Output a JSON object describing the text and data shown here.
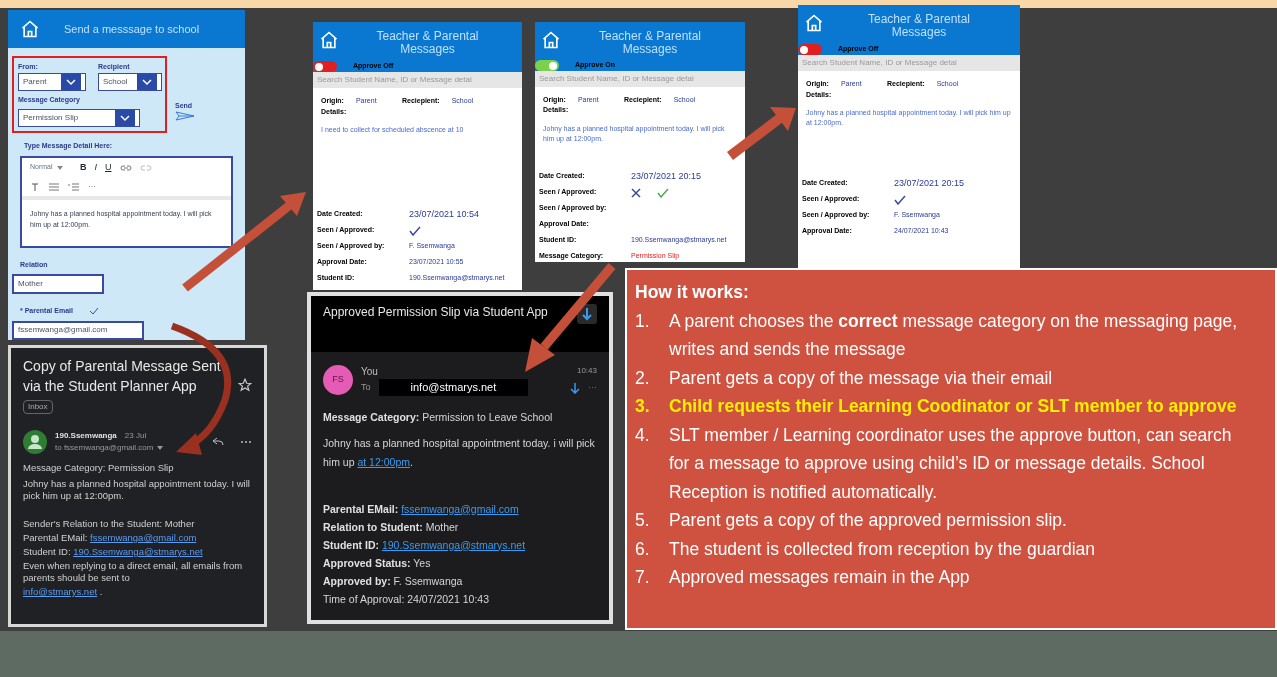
{
  "send_form": {
    "title": "Send a messsage to school",
    "from_label": "From:",
    "from_value": "Parent",
    "recipient_label": "Recipient",
    "recipient_value": "School",
    "category_label": "Message Category",
    "category_value": "Permission Slip",
    "send_label": "Send",
    "detail_label": "Type Message Detail Here:",
    "style_value": "Normal",
    "format_buttons": [
      "B",
      "I",
      "U"
    ],
    "more": "···",
    "message": "Johny has a planned hospital appointment today. I will pick him up at 12:00pm.",
    "relation_label": "Relation",
    "relation_value": "Mother",
    "email_label": "* Parental Email",
    "email_value": "fssemwanga@gmail.com"
  },
  "copy_email": {
    "title": "Copy of Parental Message Sent via the Student Planner App",
    "tag": "Inbox",
    "sender": "190.Ssemwanga",
    "date": "23 Jul",
    "to": "to fssemwanga@gmail.com",
    "body": [
      {
        "text": "Message Category: Permission Slip"
      },
      {
        "text": "Johny has a planned hospital appointment today. I will pick him up at 12:00pm."
      }
    ],
    "details": [
      {
        "text": "Sender's Relation to the Student: Mother"
      },
      {
        "text": "Parental EMail: ",
        "link": "fssemwanga@gmail.com"
      },
      {
        "text": "Student ID: ",
        "link": "190.Ssemwanga@stmarys.net"
      },
      {
        "text": "Even when replying to a direct email, all emails from parents should be sent to"
      },
      {
        "link": "info@stmarys.net",
        "after": " ."
      }
    ]
  },
  "approval_panels": [
    {
      "title": "Teacher & Parental Messages",
      "toggle": {
        "on": false,
        "label": "Approve Off"
      },
      "search_placeholder": "Search Student Name, ID or Message detai",
      "origin_label": "Origin:",
      "origin": "Parent",
      "recipient_label": "Reciepient:",
      "recipient": "School",
      "details_label": "Details:",
      "message": "I need to collect for scheduled abscence at 10",
      "fields": [
        {
          "kind": "date",
          "label": "Date Created:",
          "value": "23/07/2021 10:54"
        },
        {
          "kind": "status",
          "label": "Seen / Approved:",
          "approved": true
        },
        {
          "kind": "text",
          "label": "Seen / Approved by:",
          "value": "F. Ssemwanga"
        },
        {
          "kind": "text",
          "label": "Approval Date:",
          "value": "23/07/2021 10:55"
        },
        {
          "kind": "text",
          "label": "Student ID:",
          "value": "190.Ssemwanga@stmarys.net"
        }
      ]
    },
    {
      "title": "Teacher & Parental Messages",
      "toggle": {
        "on": true,
        "label": "Approve On"
      },
      "search_placeholder": "Search Student Name, ID or Message detai",
      "origin_label": "Origin:",
      "origin": "Parent",
      "recipient_label": "Reciepient:",
      "recipient": "School",
      "details_label": "Details:",
      "message": "Johny has a planned hospital appointment today. I will pick him up at 12:00pm.",
      "fields": [
        {
          "kind": "date",
          "label": "Date Created:",
          "value": "23/07/2021 20:15"
        },
        {
          "kind": "status",
          "label": "Seen / Approved:",
          "approved": false
        },
        {
          "kind": "text",
          "label": "Seen / Approved by:"
        },
        {
          "kind": "text",
          "label": "Approval Date:"
        },
        {
          "kind": "text",
          "label": "Student ID:",
          "value": "190.Ssemwanga@stmarys.net"
        },
        {
          "kind": "category",
          "label": "Message Category:",
          "value": "Permission Slip"
        }
      ]
    },
    {
      "title": "Teacher & Parental Messages",
      "toggle": {
        "on": false,
        "label": "Approve Off"
      },
      "search_placeholder": "Search Student Name, ID or Message detai",
      "origin_label": "Origin:",
      "origin": "Parent",
      "recipient_label": "Reciepient:",
      "recipient": "School",
      "details_label": "Details:",
      "message": "Johny has a planned hospital appointment today. I will pick him up at 12:00pm.",
      "fields": [
        {
          "kind": "date",
          "label": "Date Created:",
          "value": "23/07/2021 20:15"
        },
        {
          "kind": "status",
          "label": "Seen / Approved:",
          "approved": true
        },
        {
          "kind": "text",
          "label": "Seen / Approved by:",
          "value": "F. Ssemwanga"
        },
        {
          "kind": "text",
          "label": "Approval Date:",
          "value": "24/07/2021 10:43"
        }
      ]
    }
  ],
  "approved_email": {
    "title": "Approved Permission Slip via Student App",
    "avatar": "FS",
    "from": "You",
    "to_label": "To",
    "to": "info@stmarys.net",
    "time": "10:43",
    "more": "···",
    "category_label": "Message Category:",
    "category": "Permission to Leave School",
    "message": "Johny has a planned hospital appointment today. i will pick him up ",
    "message_link": "at 12:00pm",
    "message_end": ".",
    "rows": [
      {
        "label": "Parental EMail:",
        "value": "fssemwanga@gmail.com",
        "kind": "link"
      },
      {
        "label": "Relation to Student:",
        "value": "Mother",
        "kind": "text"
      },
      {
        "label": "Student ID:",
        "value": "190.Ssemwanga@stmarys.net",
        "kind": "link"
      },
      {
        "label": "Approved Status:",
        "value": "Yes",
        "kind": "text"
      },
      {
        "label": "Approved by:",
        "value": "F. Ssemwanga",
        "kind": "text"
      },
      {
        "label": "Time of Approval:",
        "value": "24/07/2021 10:43",
        "kind": "plain"
      }
    ]
  },
  "how_it_works": {
    "title": "How it works:",
    "steps": [
      {
        "number": "1.",
        "text": "A parent chooses the **correct** message category on the messaging page, writes and sends the message",
        "highlight": false
      },
      {
        "number": "2.",
        "text": "Parent gets a copy of the message via their email",
        "highlight": false
      },
      {
        "number": "3.",
        "text": "Child requests their Learning Coodinator or SLT member to approve",
        "highlight": true
      },
      {
        "number": "4.",
        "text": "SLT member / Learning coordinator uses the approve button, can search for a message to approve using child’s ID or message details.  School Reception is notified automatically.",
        "highlight": false
      },
      {
        "number": "5.",
        "text": "Parent gets a copy of the approved permission slip.",
        "highlight": false
      },
      {
        "number": "6.",
        "text": "The student is collected from reception by the guardian",
        "highlight": false
      },
      {
        "number": "7.",
        "text": "Approved messages  remain in the App",
        "highlight": false
      }
    ]
  }
}
